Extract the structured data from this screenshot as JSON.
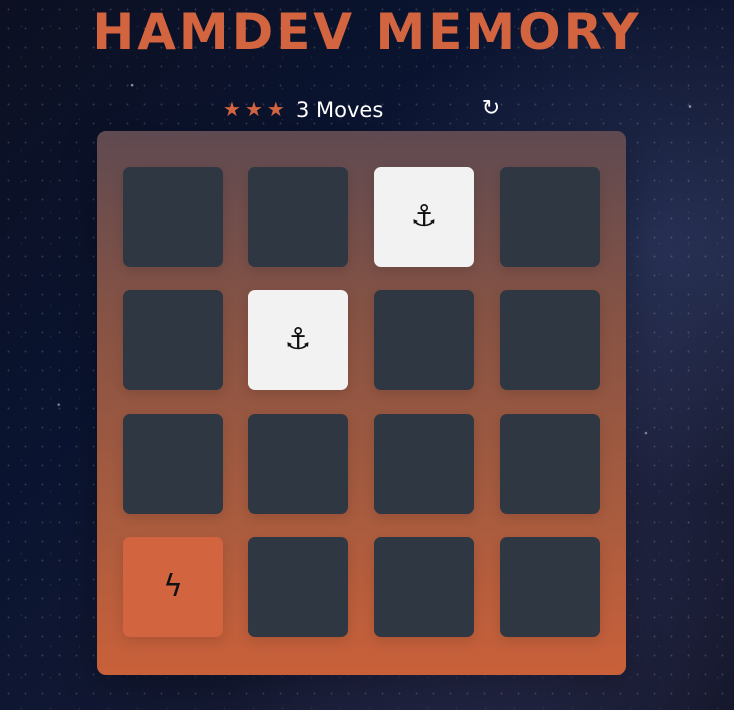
{
  "header": {
    "title": "HAMDEV MEMORY"
  },
  "score_panel": {
    "rating": 3,
    "stars": [
      {
        "symbol": "★"
      },
      {
        "symbol": "★"
      },
      {
        "symbol": "★"
      }
    ],
    "moves_text": "3 Moves",
    "restart_icon": {
      "name": "restart-icon",
      "symbol": "↻"
    }
  },
  "deck": {
    "cards": [
      {
        "state": "hidden",
        "icon": "",
        "symbol": ""
      },
      {
        "state": "hidden",
        "icon": "",
        "symbol": ""
      },
      {
        "state": "open",
        "icon": "anchor-icon",
        "symbol": "⚓"
      },
      {
        "state": "hidden",
        "icon": "",
        "symbol": ""
      },
      {
        "state": "hidden",
        "icon": "",
        "symbol": ""
      },
      {
        "state": "open",
        "icon": "anchor-icon",
        "symbol": "⚓"
      },
      {
        "state": "hidden",
        "icon": "",
        "symbol": ""
      },
      {
        "state": "hidden",
        "icon": "",
        "symbol": ""
      },
      {
        "state": "hidden",
        "icon": "",
        "symbol": ""
      },
      {
        "state": "hidden",
        "icon": "",
        "symbol": ""
      },
      {
        "state": "hidden",
        "icon": "",
        "symbol": ""
      },
      {
        "state": "hidden",
        "icon": "",
        "symbol": ""
      },
      {
        "state": "match",
        "icon": "lightning-icon",
        "symbol": "ϟ"
      },
      {
        "state": "hidden",
        "icon": "",
        "symbol": ""
      },
      {
        "state": "hidden",
        "icon": "",
        "symbol": ""
      },
      {
        "state": "hidden",
        "icon": "",
        "symbol": ""
      }
    ]
  },
  "colors": {
    "title": "#d2643f",
    "card_hidden": "#2f3742",
    "card_open": "#f2f2f2",
    "card_match": "#d2643f",
    "star": "#d2643f"
  }
}
